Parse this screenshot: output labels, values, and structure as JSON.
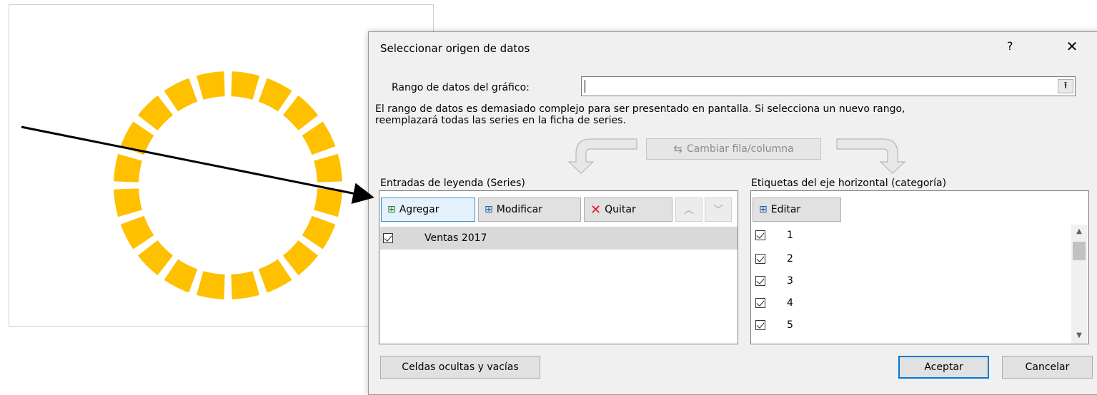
{
  "dialog": {
    "title": "Seleccionar origen de datos",
    "help_label": "?",
    "close_label": "✕",
    "range_label": "Rango de datos del gráfico:",
    "range_value": "",
    "info_line1": "El rango de datos es demasiado complejo para ser presentado en pantalla. Si selecciona un nuevo rango,",
    "info_line2": "reemplazará todas las series en la ficha de series.",
    "switch_label": "Cambiar fila/columna",
    "series_group_label": "Entradas de leyenda (Series)",
    "series_toolbar": {
      "add_label": "Agregar",
      "edit_label": "Modificar",
      "remove_label": "Quitar"
    },
    "series": [
      {
        "name": "Ventas 2017",
        "checked": true
      }
    ],
    "categories_group_label": "Etiquetas del eje horizontal (categoría)",
    "categories_edit_label": "Editar",
    "categories": [
      "1",
      "2",
      "3",
      "4",
      "5"
    ],
    "hidden_cells_label": "Celdas ocultas y vacías",
    "ok_label": "Aceptar",
    "cancel_label": "Cancelar"
  },
  "chart": {
    "type": "doughnut",
    "segment_color": "#FFC000",
    "segment_count": 20
  },
  "colors": {
    "accent": "#0078d7",
    "dialog_bg": "#f0f0f0",
    "selected_row": "#d9d9d9"
  }
}
